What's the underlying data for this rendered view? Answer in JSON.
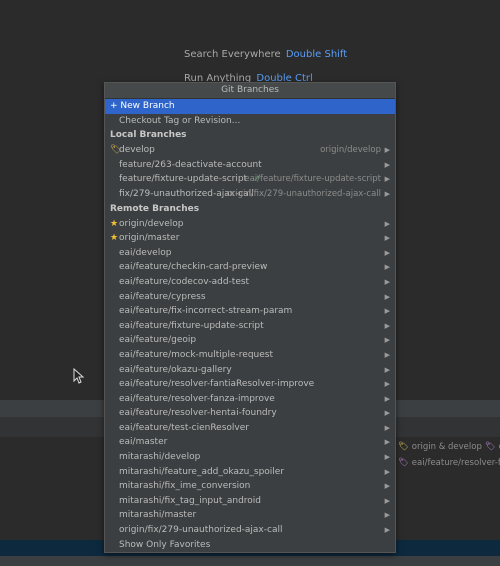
{
  "background": {
    "hints": [
      {
        "label": "Search Everywhere",
        "key": "Double Shift"
      },
      {
        "label": "Run Anything",
        "key": "Double Ctrl"
      }
    ],
    "log_rows": [
      {
        "tags": "origin & develop",
        "extra": "o"
      },
      {
        "tags": "eai/feature/resolver-fanza",
        "extra": ""
      }
    ]
  },
  "popup": {
    "title": "Git Branches",
    "actions": {
      "new_branch": "+ New Branch",
      "checkout": "Checkout Tag or Revision..."
    },
    "local_header": "Local Branches",
    "local": [
      {
        "name": "develop",
        "tracking": "origin/develop",
        "icon": "tag-icon"
      },
      {
        "name": "feature/263-deactivate-account",
        "tracking": ""
      },
      {
        "name": "feature/fixture-update-script",
        "tracking": "eai/feature/fixture-update-script",
        "outgoing": "↗"
      },
      {
        "name": "fix/279-unauthorized-ajax-call",
        "tracking": "origin/fix/279-unauthorized-ajax-call"
      }
    ],
    "remote_header": "Remote Branches",
    "remote": [
      {
        "name": "origin/develop",
        "favorite": true
      },
      {
        "name": "origin/master",
        "favorite": true
      },
      {
        "name": "eai/develop"
      },
      {
        "name": "eai/feature/checkin-card-preview"
      },
      {
        "name": "eai/feature/codecov-add-test"
      },
      {
        "name": "eai/feature/cypress"
      },
      {
        "name": "eai/feature/fix-incorrect-stream-param"
      },
      {
        "name": "eai/feature/fixture-update-script"
      },
      {
        "name": "eai/feature/geoip"
      },
      {
        "name": "eai/feature/mock-multiple-request"
      },
      {
        "name": "eai/feature/okazu-gallery"
      },
      {
        "name": "eai/feature/resolver-fantiaResolver-improve"
      },
      {
        "name": "eai/feature/resolver-fanza-improve"
      },
      {
        "name": "eai/feature/resolver-hentai-foundry"
      },
      {
        "name": "eai/feature/test-cienResolver"
      },
      {
        "name": "eai/master"
      },
      {
        "name": "mitarashi/develop"
      },
      {
        "name": "mitarashi/feature_add_okazu_spoiler"
      },
      {
        "name": "mitarashi/fix_ime_conversion"
      },
      {
        "name": "mitarashi/fix_tag_input_android"
      },
      {
        "name": "mitarashi/master"
      },
      {
        "name": "origin/fix/279-unauthorized-ajax-call"
      }
    ],
    "footer": "Show Only Favorites"
  }
}
